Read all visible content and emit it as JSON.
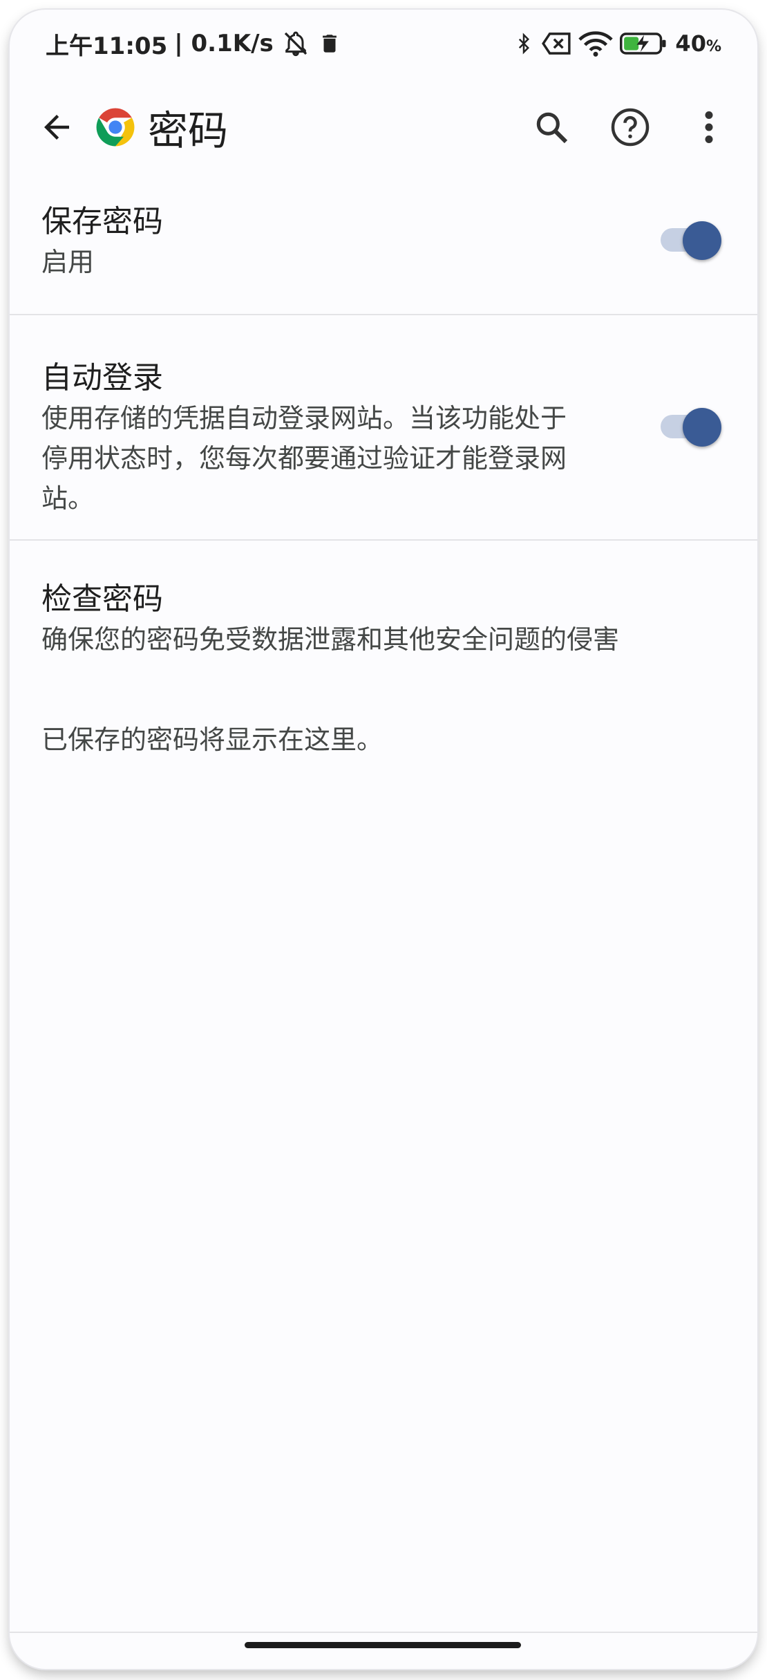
{
  "status_bar": {
    "time": "上午11:05",
    "net_speed": "| 0.1K/s",
    "battery": "40",
    "battery_unit": "%"
  },
  "app_bar": {
    "title": "密码",
    "icons": [
      "back-arrow-icon",
      "chrome-logo",
      "search-icon",
      "help-icon",
      "more-vert-icon"
    ]
  },
  "settings": {
    "save_passwords": {
      "title": "保存密码",
      "subtitle": "启用",
      "enabled": true
    },
    "auto_signin": {
      "title": "自动登录",
      "subtitle_line1": "使用存储的凭据自动登录网站。当该功能处于",
      "subtitle_line2": "停用状态时，您每次都要通过验证才能登录网",
      "subtitle_line3": "站。",
      "enabled": true
    },
    "check_passwords": {
      "title": "检查密码",
      "subtitle": "确保您的密码免受数据泄露和其他安全问题的侵害"
    }
  },
  "empty_note": "已保存的密码将显示在这里。",
  "colors": {
    "accent": "#3a5b95",
    "track": "#c6d0e3",
    "background": "#fcfcfe"
  }
}
